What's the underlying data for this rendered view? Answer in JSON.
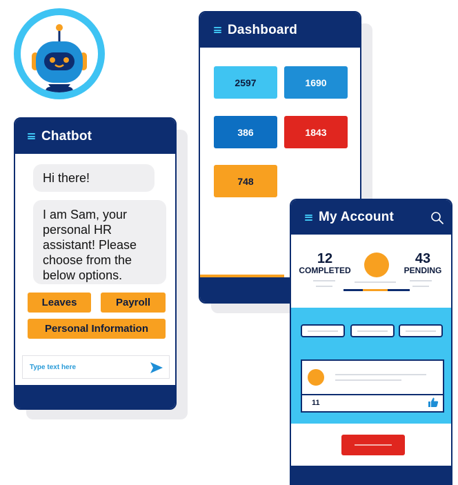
{
  "colors": {
    "navy": "#0d2d70",
    "cyan": "#3fc4f2",
    "orange": "#f8a020",
    "red": "#e0261f",
    "blue": "#1e8ed6",
    "bubble": "#efeff1"
  },
  "robot": {
    "icon": "robot-avatar-icon"
  },
  "chatbot": {
    "title": "Chatbot",
    "messages": [
      "Hi there!",
      "I am Sam, your personal HR assistant! Please choose from the below options."
    ],
    "options": [
      "Leaves",
      "Payroll",
      "Personal Information"
    ],
    "input_placeholder": "Type text here",
    "send_icon": "send-icon"
  },
  "dashboard": {
    "title": "Dashboard",
    "tiles": [
      "2597",
      "1690",
      "386",
      "1843",
      "748"
    ]
  },
  "account": {
    "title": "My Account",
    "search_icon": "search-icon",
    "completed": {
      "value": "12",
      "label": "COMPLETED"
    },
    "pending": {
      "value": "43",
      "label": "PENDING"
    },
    "post": {
      "count": "11",
      "like_icon": "thumbs-up-icon"
    }
  }
}
